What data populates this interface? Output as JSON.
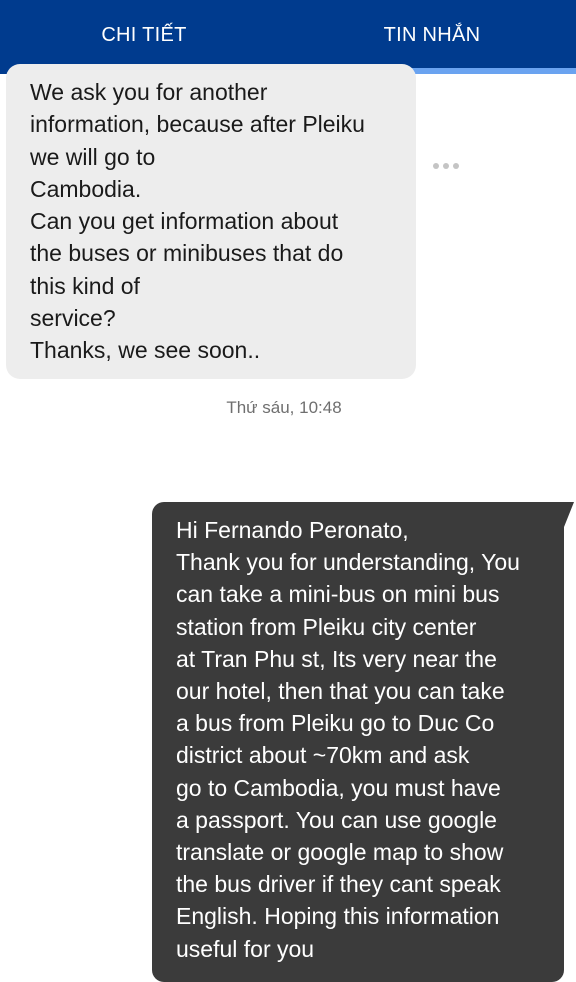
{
  "tabs": [
    {
      "label": "CHI TIẾT"
    },
    {
      "label": "TIN NHẮN"
    }
  ],
  "messages": {
    "received": {
      "lines": [
        "We ask you for another",
        "information, because after Pleiku",
        "we will go to",
        "Cambodia.",
        "Can you get information about",
        "the buses or minibuses that do",
        "this kind of",
        "service?",
        "Thanks, we see soon.."
      ]
    },
    "timestamp": "Thứ sáu, 10:48",
    "sent": {
      "lines": [
        "Hi Fernando Peronato,",
        "Thank you for understanding, You",
        "can take a mini-bus on mini bus",
        "station from Pleiku city center",
        "at Tran Phu st, Its very near the",
        "our hotel, then that you can take",
        "a bus from Pleiku go to Duc Co",
        "district about ~70km and ask",
        "go to Cambodia, you must have",
        "a passport. You can use google",
        "translate or google map to show",
        "the bus driver if they cant speak",
        "English. Hoping this information",
        "useful for you"
      ]
    }
  },
  "colors": {
    "header": "#003b8e",
    "tab_indicator": "#6aa3f0",
    "received_bubble": "#ededed",
    "sent_bubble": "#3b3b3b"
  },
  "icons": {
    "more": "more-horizontal-icon"
  }
}
